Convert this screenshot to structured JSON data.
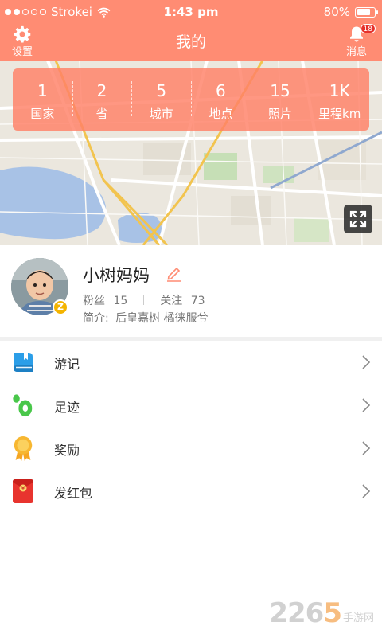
{
  "status_bar": {
    "carrier": "Strokei",
    "time": "1:43 pm",
    "battery": "80%",
    "battery_level": 0.8
  },
  "nav": {
    "title": "我的",
    "settings_label": "设置",
    "messages_label": "消息",
    "messages_badge": "18"
  },
  "stats": [
    {
      "value": "1",
      "label": "国家"
    },
    {
      "value": "2",
      "label": "省"
    },
    {
      "value": "5",
      "label": "城市"
    },
    {
      "value": "6",
      "label": "地点"
    },
    {
      "value": "15",
      "label": "照片"
    },
    {
      "value": "1K",
      "label": "里程km"
    }
  ],
  "profile": {
    "name": "小树妈妈",
    "fans_label": "粉丝",
    "fans_count": "15",
    "following_label": "关注",
    "following_count": "73",
    "intro_label": "简介:",
    "intro_text": "后皇嘉树 橘徕服兮",
    "avatar_badge": "Z"
  },
  "menu": [
    {
      "label": "游记",
      "icon": "book-icon"
    },
    {
      "label": "足迹",
      "icon": "footprint-icon"
    },
    {
      "label": "奖励",
      "icon": "medal-icon"
    },
    {
      "label": "发红包",
      "icon": "red-envelope-icon"
    }
  ],
  "watermark": {
    "number_a": "22",
    "number_b": "6",
    "number_c": "5",
    "text": "手游网"
  },
  "colors": {
    "accent": "#ff8c73",
    "badge": "#e6312b"
  }
}
